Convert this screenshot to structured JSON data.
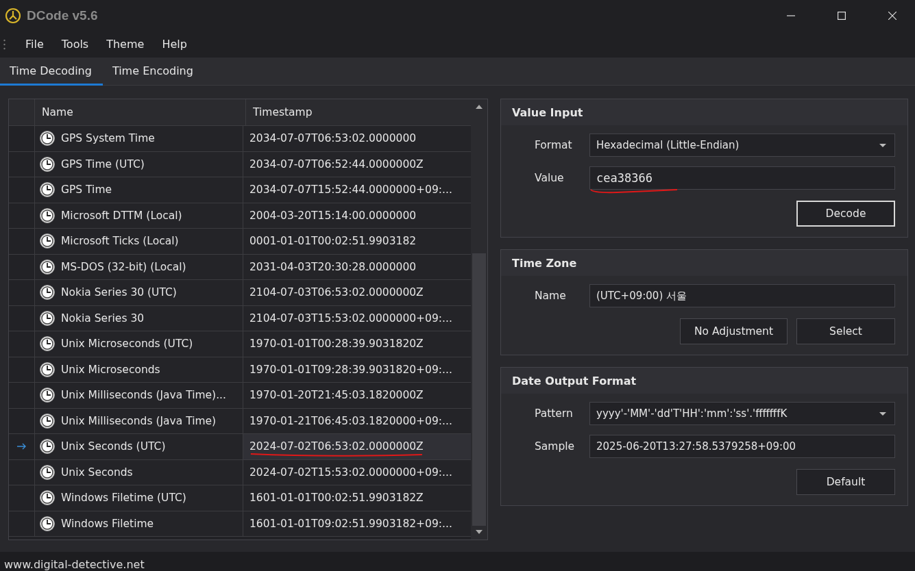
{
  "window": {
    "title": "DCode v5.6"
  },
  "menu": [
    "File",
    "Tools",
    "Theme",
    "Help"
  ],
  "tabs": [
    {
      "label": "Time Decoding",
      "selected": true
    },
    {
      "label": "Time Encoding",
      "selected": false
    }
  ],
  "table": {
    "columns": [
      "Name",
      "Timestamp"
    ],
    "rows": [
      {
        "name": "GPS System Time",
        "timestamp": "2034-07-07T06:53:02.0000000",
        "selected": false,
        "underlined": false
      },
      {
        "name": "GPS Time (UTC)",
        "timestamp": "2034-07-07T06:52:44.0000000Z",
        "selected": false,
        "underlined": false
      },
      {
        "name": "GPS Time",
        "timestamp": "2034-07-07T15:52:44.0000000+09:...",
        "selected": false,
        "underlined": false
      },
      {
        "name": "Microsoft DTTM (Local)",
        "timestamp": "2004-03-20T15:14:00.0000000",
        "selected": false,
        "underlined": false
      },
      {
        "name": "Microsoft Ticks (Local)",
        "timestamp": "0001-01-01T00:02:51.9903182",
        "selected": false,
        "underlined": false
      },
      {
        "name": "MS-DOS (32-bit) (Local)",
        "timestamp": "2031-04-03T20:30:28.0000000",
        "selected": false,
        "underlined": false
      },
      {
        "name": "Nokia Series 30 (UTC)",
        "timestamp": "2104-07-03T06:53:02.0000000Z",
        "selected": false,
        "underlined": false
      },
      {
        "name": "Nokia Series 30",
        "timestamp": "2104-07-03T15:53:02.0000000+09:...",
        "selected": false,
        "underlined": false
      },
      {
        "name": "Unix Microseconds (UTC)",
        "timestamp": "1970-01-01T00:28:39.9031820Z",
        "selected": false,
        "underlined": false
      },
      {
        "name": "Unix Microseconds",
        "timestamp": "1970-01-01T09:28:39.9031820+09:...",
        "selected": false,
        "underlined": false
      },
      {
        "name": "Unix Milliseconds (Java Time)...",
        "timestamp": "1970-01-20T21:45:03.1820000Z",
        "selected": false,
        "underlined": false
      },
      {
        "name": "Unix Milliseconds (Java Time)",
        "timestamp": "1970-01-21T06:45:03.1820000+09:...",
        "selected": false,
        "underlined": false
      },
      {
        "name": "Unix Seconds (UTC)",
        "timestamp": "2024-07-02T06:53:02.0000000Z",
        "selected": true,
        "underlined": true
      },
      {
        "name": "Unix Seconds",
        "timestamp": "2024-07-02T15:53:02.0000000+09:...",
        "selected": false,
        "underlined": false
      },
      {
        "name": "Windows Filetime (UTC)",
        "timestamp": "1601-01-01T00:02:51.9903182Z",
        "selected": false,
        "underlined": false
      },
      {
        "name": "Windows Filetime",
        "timestamp": "1601-01-01T09:02:51.9903182+09:...",
        "selected": false,
        "underlined": false
      }
    ]
  },
  "value_input": {
    "title": "Value Input",
    "format_label": "Format",
    "format": "Hexadecimal (Little-Endian)",
    "value_label": "Value",
    "value": "cea38366",
    "value_underlined": true,
    "button": "Decode"
  },
  "time_zone": {
    "title": "Time Zone",
    "name_label": "Name",
    "name": "(UTC+09:00) 서울",
    "buttons": [
      "No Adjustment",
      "Select"
    ]
  },
  "date_output_format": {
    "title": "Date Output Format",
    "pattern_label": "Pattern",
    "pattern": "yyyy'-'MM'-'dd'T'HH':'mm':'ss'.'fffffffK",
    "sample_label": "Sample",
    "sample": "2025-06-20T13:27:58.5379258+09:00",
    "button": "Default"
  },
  "status_bar": {
    "text": "www.digital-detective.net"
  }
}
